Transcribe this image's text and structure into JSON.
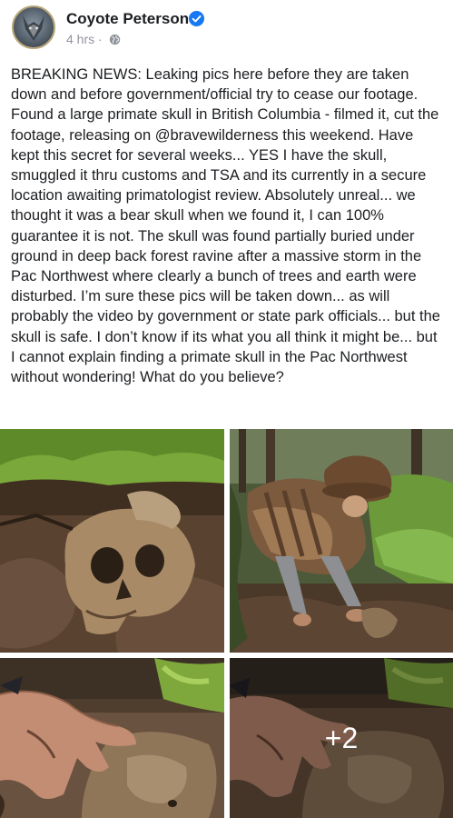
{
  "post": {
    "author": "Coyote Peterson",
    "timestamp": "4 hrs",
    "separator": "·",
    "body": "BREAKING NEWS: Leaking pics here before they are taken down and before government/official try to cease our footage. Found a large primate skull in British Columbia - filmed it, cut the footage, releasing on @bravewilderness this weekend. Have kept this secret for several weeks... YES I have the skull, smuggled it thru customs and TSA and its currently in a secure location awaiting primatologist review. Absolutely unreal... we thought it was a bear skull when we found it, I can 100% guarantee it is not. The skull was found partially buried under ground in deep back forest ravine after a massive storm in the Pac Northwest where clearly a bunch of trees and earth were disturbed. I’m sure these pics will be taken down... as will probably the video by government or state park officials... but the skull is safe. I don’t know if its what you all think it might be... but I cannot explain finding a primate skull in the Pac Northwest without wondering! What do you believe?",
    "icons": {
      "avatar": "coyote-logo",
      "verified": "verified-badge-icon",
      "privacy": "globe-icon"
    },
    "colors": {
      "verified_blue": "#1877f2",
      "meta_gray": "#90949c"
    }
  },
  "photos": {
    "more_count": "+2"
  }
}
